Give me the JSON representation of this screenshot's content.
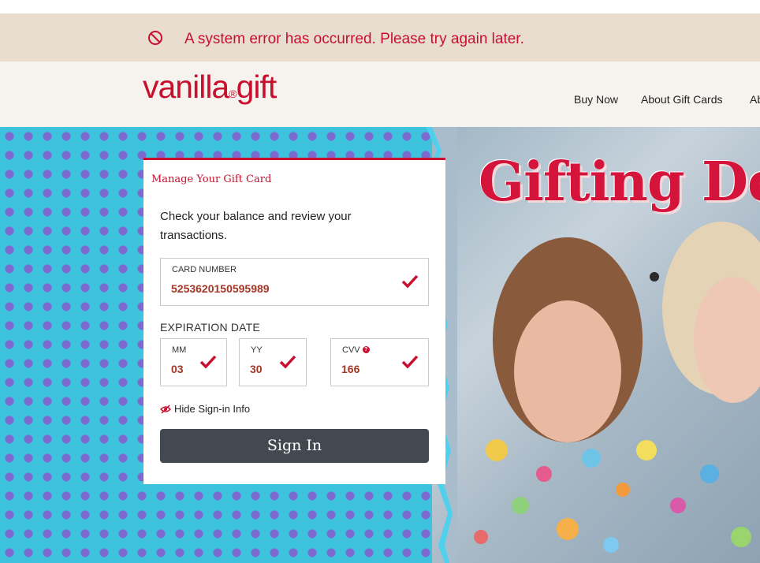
{
  "error_banner": {
    "message": "A system error has occurred. Please try again later."
  },
  "header": {
    "logo": {
      "word1": "vanilla",
      "dot": "®",
      "word2": "gift"
    },
    "nav": [
      "Buy Now",
      "About Gift Cards",
      "Ab"
    ]
  },
  "hero": {
    "title": "Gifting De"
  },
  "signin_card": {
    "title": "Manage Your Gift Card",
    "description": "Check your balance and review your transactions.",
    "card_number": {
      "label": "CARD NUMBER",
      "value": "5253620150595989"
    },
    "expiration_label": "EXPIRATION DATE",
    "month": {
      "label": "MM",
      "value": "03"
    },
    "year": {
      "label": "YY",
      "value": "30"
    },
    "cvv": {
      "label": "CVV",
      "value": "166",
      "info": "?"
    },
    "toggle_label": "Hide Sign-in Info",
    "submit_label": "Sign In"
  },
  "colors": {
    "brand_red": "#c8102e",
    "error_bg": "#e9ddcf",
    "button": "#434950",
    "hero_blue": "#3ec3df",
    "dots": "#7c6ad0"
  },
  "icons": [
    "no-entry-icon",
    "checkmark-icon",
    "eye-slash-icon",
    "info-icon"
  ]
}
